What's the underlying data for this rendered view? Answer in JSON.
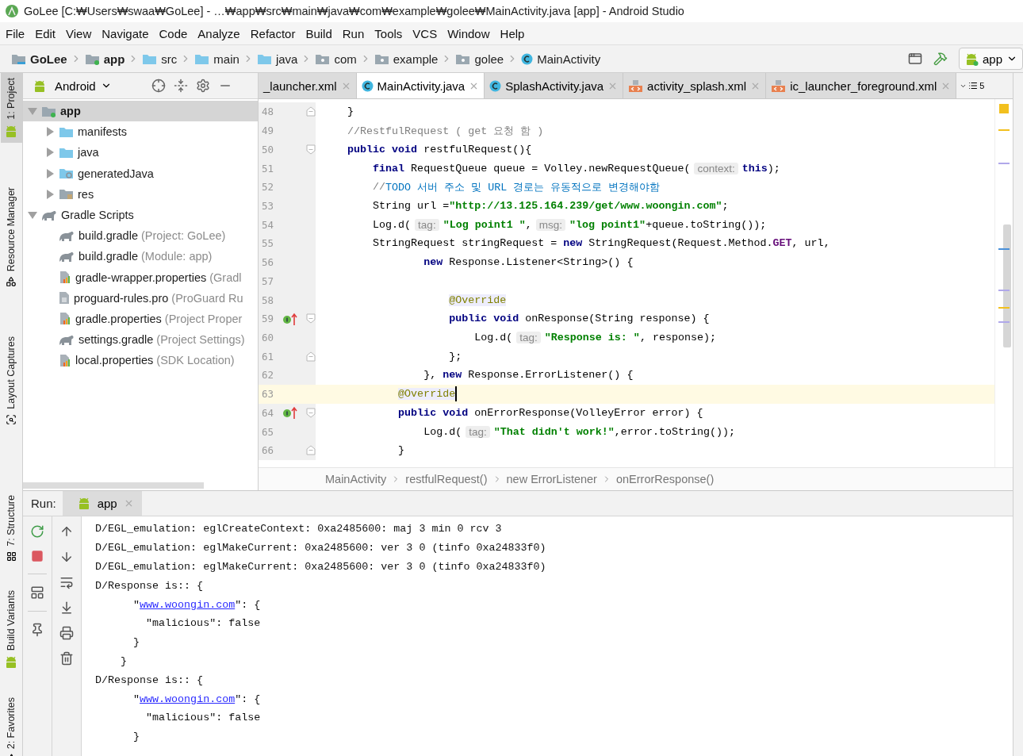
{
  "window": {
    "title": "GoLee [C:₩Users₩swaa₩GoLee] - …₩app₩src₩main₩java₩com₩example₩golee₩MainActivity.java [app] - Android Studio"
  },
  "menu": [
    "File",
    "Edit",
    "View",
    "Navigate",
    "Code",
    "Analyze",
    "Refactor",
    "Build",
    "Run",
    "Tools",
    "VCS",
    "Window",
    "Help"
  ],
  "nav_bar": {
    "crumbs": [
      {
        "label": "GoLee",
        "kind": "project",
        "bold": true
      },
      {
        "label": "app",
        "kind": "module",
        "bold": true
      },
      {
        "label": "src",
        "kind": "folder",
        "bold": false
      },
      {
        "label": "main",
        "kind": "folder",
        "bold": false
      },
      {
        "label": "java",
        "kind": "source",
        "bold": false
      },
      {
        "label": "com",
        "kind": "package",
        "bold": false
      },
      {
        "label": "example",
        "kind": "package",
        "bold": false
      },
      {
        "label": "golee",
        "kind": "package",
        "bold": false
      },
      {
        "label": "MainActivity",
        "kind": "class",
        "bold": false
      }
    ],
    "run_config": "app"
  },
  "side_tabs_top": [
    {
      "label": "1: Project",
      "selected": true
    },
    {
      "label": "Resource Manager",
      "selected": false
    },
    {
      "label": "Layout Captures",
      "selected": false
    }
  ],
  "side_tabs_bottom": [
    {
      "label": "7: Structure",
      "selected": false
    },
    {
      "label": "Build Variants",
      "selected": false
    },
    {
      "label": "2: Favorites",
      "selected": false
    }
  ],
  "project": {
    "view": "Android",
    "tree": [
      {
        "label": "app",
        "kind": "module",
        "selected": true,
        "expanded": true,
        "children": [
          {
            "label": "manifests",
            "kind": "folder",
            "selected": false,
            "expanded": false
          },
          {
            "label": "java",
            "kind": "folder",
            "selected": false,
            "expanded": false
          },
          {
            "label": "generatedJava",
            "kind": "generated",
            "selected": false,
            "expanded": false
          },
          {
            "label": "res",
            "kind": "res",
            "selected": false,
            "expanded": false
          }
        ]
      },
      {
        "label": "Gradle Scripts",
        "kind": "gradle",
        "selected": false,
        "expanded": true,
        "children": [
          {
            "label": "build.gradle",
            "detail": "(Project: GoLee)",
            "kind": "gradle",
            "selected": false
          },
          {
            "label": "build.gradle",
            "detail": "(Module: app)",
            "kind": "gradle",
            "selected": false
          },
          {
            "label": "gradle-wrapper.properties",
            "detail": "(Gradl",
            "kind": "props",
            "selected": false
          },
          {
            "label": "proguard-rules.pro",
            "detail": "(ProGuard Ru",
            "kind": "text",
            "selected": false
          },
          {
            "label": "gradle.properties",
            "detail": "(Project Proper",
            "kind": "props",
            "selected": false
          },
          {
            "label": "settings.gradle",
            "detail": "(Project Settings)",
            "kind": "gradle",
            "selected": false
          },
          {
            "label": "local.properties",
            "detail": "(SDK Location)",
            "kind": "props",
            "selected": false
          }
        ]
      }
    ]
  },
  "editor": {
    "tabs": [
      {
        "label": "_launcher.xml",
        "kind": "plain",
        "selected": false
      },
      {
        "label": "MainActivity.java",
        "kind": "class",
        "selected": true
      },
      {
        "label": "SplashActivity.java",
        "kind": "class",
        "selected": false
      },
      {
        "label": "activity_splash.xml",
        "kind": "xml",
        "selected": false
      },
      {
        "label": "ic_launcher_foreground.xml",
        "kind": "xml",
        "selected": false
      }
    ],
    "tab_count": "5",
    "lines": [
      {
        "number": "48",
        "fold_end": true,
        "current": false,
        "tokens": [
          {
            "kind": "plain",
            "text": "    }"
          }
        ]
      },
      {
        "number": "49",
        "current": false,
        "tokens": [
          {
            "kind": "comment",
            "text": "    //RestfulRequest ( get 요청 함 )"
          }
        ]
      },
      {
        "number": "50",
        "fold_start": true,
        "current": false,
        "tokens": [
          {
            "kind": "keyword",
            "text": "    public void"
          },
          {
            "kind": "plain",
            "text": " restfulRequest(){"
          }
        ]
      },
      {
        "number": "51",
        "current": false,
        "tokens": [
          {
            "kind": "keyword",
            "text": "        final"
          },
          {
            "kind": "plain",
            "text": " RequestQueue queue = Volley.newRequestQueue("
          },
          {
            "kind": "hint",
            "text": "context:"
          },
          {
            "kind": "keyword",
            "text": "this"
          },
          {
            "kind": "plain",
            "text": ");"
          }
        ]
      },
      {
        "number": "52",
        "current": false,
        "tokens": [
          {
            "kind": "comment",
            "text": "        //"
          },
          {
            "kind": "todo",
            "text": "TODO 서버 주소 및 URL 경로는 유동적으로 변경해야함"
          }
        ]
      },
      {
        "number": "53",
        "current": false,
        "tokens": [
          {
            "kind": "plain",
            "text": "        String url ="
          },
          {
            "kind": "string",
            "text": "\"http://13.125.164.239/get/www.woongin.com\""
          },
          {
            "kind": "plain",
            "text": ";"
          }
        ]
      },
      {
        "number": "54",
        "current": false,
        "tokens": [
          {
            "kind": "plain",
            "text": "        Log.d("
          },
          {
            "kind": "hint",
            "text": "tag:"
          },
          {
            "kind": "string",
            "text": "\"Log point1 \""
          },
          {
            "kind": "plain",
            "text": ","
          },
          {
            "kind": "hint",
            "text": "msg:"
          },
          {
            "kind": "string",
            "text": "\"log point1\""
          },
          {
            "kind": "plain",
            "text": "+queue.toString());"
          }
        ]
      },
      {
        "number": "55",
        "current": false,
        "tokens": [
          {
            "kind": "plain",
            "text": "        StringRequest stringRequest = "
          },
          {
            "kind": "keyword",
            "text": "new"
          },
          {
            "kind": "plain",
            "text": " StringRequest(Request.Method."
          },
          {
            "kind": "field",
            "text": "GET"
          },
          {
            "kind": "plain",
            "text": ", url,"
          }
        ]
      },
      {
        "number": "56",
        "current": false,
        "tokens": [
          {
            "kind": "keyword",
            "text": "                new"
          },
          {
            "kind": "plain",
            "text": " Response.Listener<String>() {"
          }
        ]
      },
      {
        "number": "57",
        "current": false
      },
      {
        "number": "58",
        "current": false,
        "tokens": [
          {
            "kind": "annotation",
            "text": "                    @Override"
          }
        ]
      },
      {
        "number": "59",
        "fold_start": true,
        "implements": true,
        "current": false,
        "tokens": [
          {
            "kind": "keyword",
            "text": "                    public void"
          },
          {
            "kind": "plain",
            "text": " onResponse(String response) {"
          }
        ]
      },
      {
        "number": "60",
        "current": false,
        "tokens": [
          {
            "kind": "plain",
            "text": "                        Log.d("
          },
          {
            "kind": "hint",
            "text": "tag:"
          },
          {
            "kind": "string",
            "text": "\"Response is: \""
          },
          {
            "kind": "plain",
            "text": ", response);"
          }
        ]
      },
      {
        "number": "61",
        "fold_end": true,
        "current": false,
        "tokens": [
          {
            "kind": "plain",
            "text": "                    };"
          }
        ]
      },
      {
        "number": "62",
        "current": false,
        "tokens": [
          {
            "kind": "plain",
            "text": "                }, "
          },
          {
            "kind": "keyword",
            "text": "new"
          },
          {
            "kind": "plain",
            "text": " Response.ErrorListener() {"
          }
        ]
      },
      {
        "number": "63",
        "current": true,
        "tokens": [
          {
            "kind": "annotation",
            "text": "            @Override"
          }
        ]
      },
      {
        "number": "64",
        "fold_start": true,
        "implements": true,
        "current": false,
        "tokens": [
          {
            "kind": "keyword",
            "text": "            public void"
          },
          {
            "kind": "plain",
            "text": " onErrorResponse(VolleyError error) {"
          }
        ]
      },
      {
        "number": "65",
        "current": false,
        "tokens": [
          {
            "kind": "plain",
            "text": "                Log.d("
          },
          {
            "kind": "hint",
            "text": "tag:"
          },
          {
            "kind": "string",
            "text": "\"That didn't work!\""
          },
          {
            "kind": "plain",
            "text": ",error.toString());"
          }
        ]
      },
      {
        "number": "66",
        "fold_end": true,
        "current": false,
        "tokens": [
          {
            "kind": "plain",
            "text": "            }"
          }
        ]
      }
    ],
    "breadcrumb": [
      "MainActivity",
      "restfulRequest()",
      "new ErrorListener",
      "onErrorResponse()"
    ]
  },
  "run": {
    "label": "Run:",
    "tabs": [
      {
        "label": "app",
        "selected": true
      }
    ],
    "console": [
      {
        "tokens": [
          {
            "kind": "text",
            "text": "D/EGL_emulation: eglCreateContext: 0xa2485600: maj 3 min 0 rcv 3"
          }
        ]
      },
      {
        "tokens": [
          {
            "kind": "text",
            "text": "D/EGL_emulation: eglMakeCurrent: 0xa2485600: ver 3 0 (tinfo 0xa24833f0)"
          }
        ]
      },
      {
        "tokens": [
          {
            "kind": "text",
            "text": "D/EGL_emulation: eglMakeCurrent: 0xa2485600: ver 3 0 (tinfo 0xa24833f0)"
          }
        ]
      },
      {
        "tokens": [
          {
            "kind": "text",
            "text": "D/Response is:: {"
          }
        ]
      },
      {
        "tokens": [
          {
            "kind": "text",
            "text": "      \""
          },
          {
            "kind": "link",
            "text": "www.woongin.com"
          },
          {
            "kind": "text",
            "text": "\": {"
          }
        ]
      },
      {
        "tokens": [
          {
            "kind": "text",
            "text": "        \"malicious\": false"
          }
        ]
      },
      {
        "tokens": [
          {
            "kind": "text",
            "text": "      }"
          }
        ]
      },
      {
        "tokens": [
          {
            "kind": "text",
            "text": "    }"
          }
        ]
      },
      {
        "tokens": [
          {
            "kind": "text",
            "text": "D/Response is:: {"
          }
        ]
      },
      {
        "tokens": [
          {
            "kind": "text",
            "text": "      \""
          },
          {
            "kind": "link",
            "text": "www.woongin.com"
          },
          {
            "kind": "text",
            "text": "\": {"
          }
        ]
      },
      {
        "tokens": [
          {
            "kind": "text",
            "text": "        \"malicious\": false"
          }
        ]
      },
      {
        "tokens": [
          {
            "kind": "text",
            "text": "      }"
          }
        ]
      }
    ]
  }
}
